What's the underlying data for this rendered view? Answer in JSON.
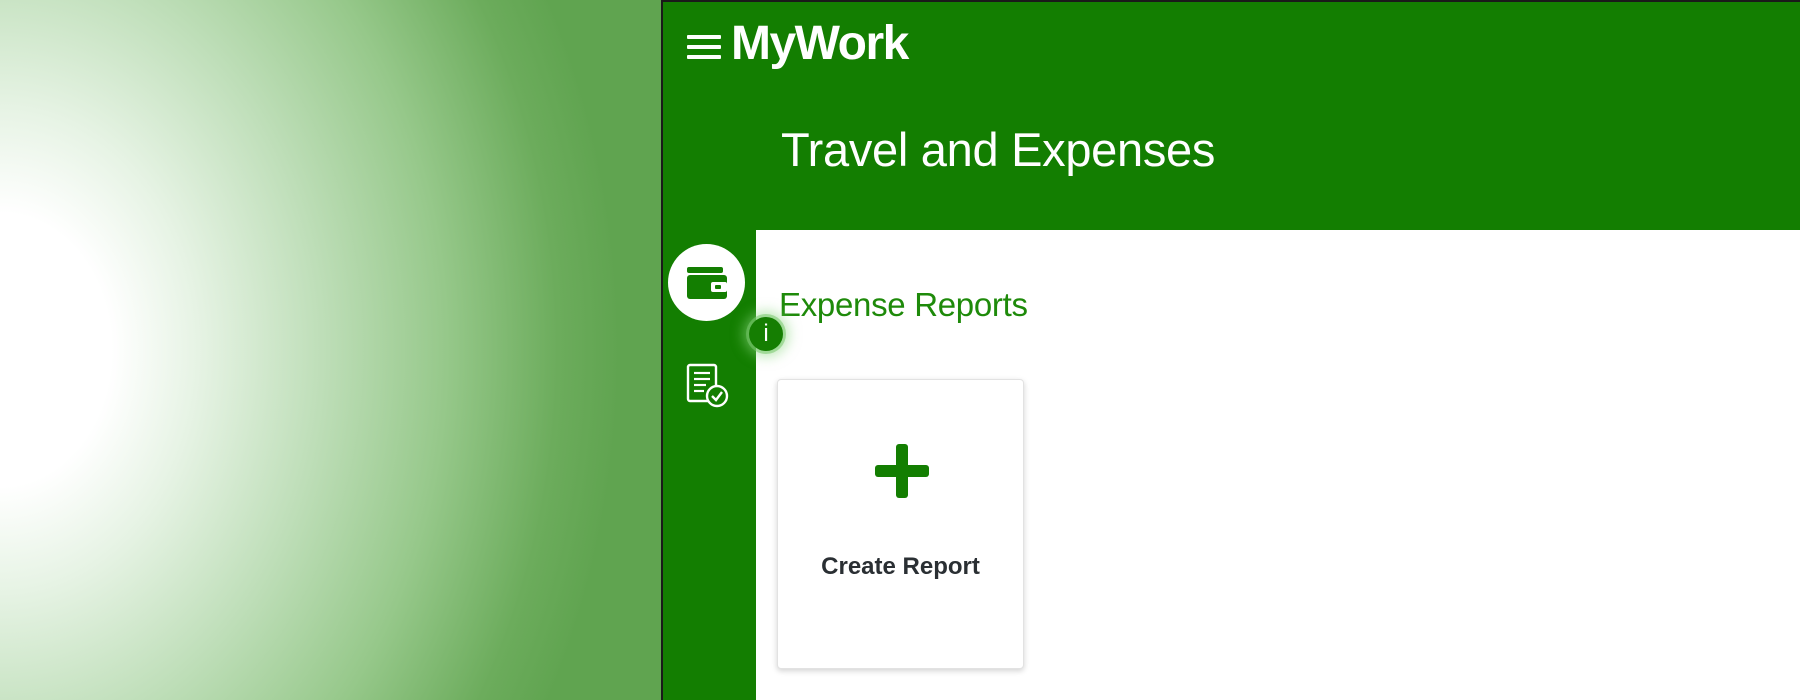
{
  "header": {
    "app_name": "MyWork",
    "page_title": "Travel and Expenses"
  },
  "sidebar": {
    "items": [
      {
        "icon": "wallet-icon",
        "active": true
      },
      {
        "icon": "document-check-icon",
        "active": false
      }
    ]
  },
  "main": {
    "section_title": "Expense Reports",
    "info_badge": "i",
    "cards": [
      {
        "label": "Create Report",
        "icon": "plus-icon"
      }
    ]
  },
  "colors": {
    "brand_green": "#137e01",
    "accent_green": "#1e8a0a",
    "card_text": "#2a2f33",
    "surface": "#ffffff"
  }
}
